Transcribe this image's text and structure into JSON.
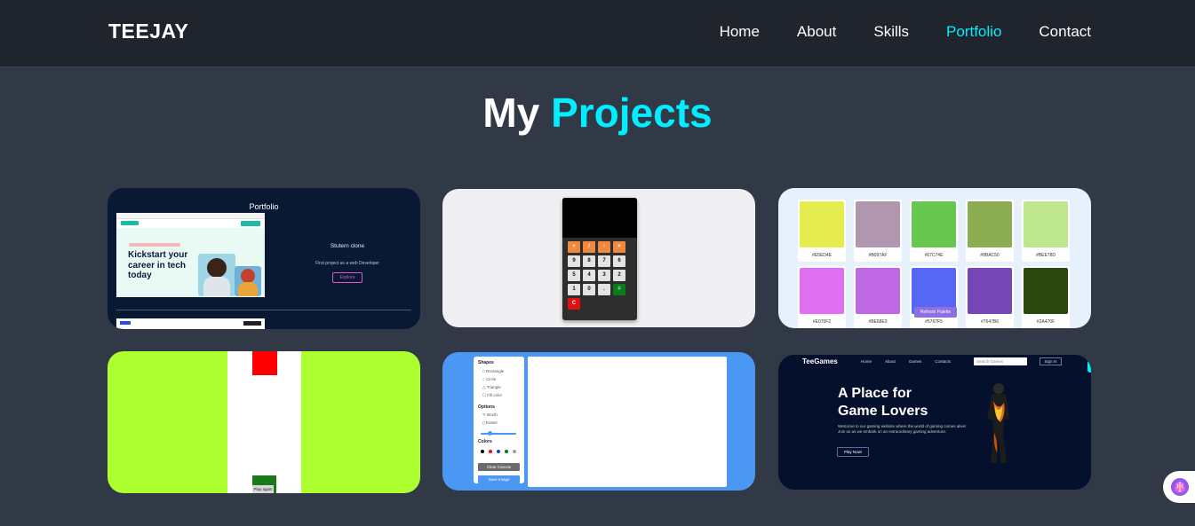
{
  "brand": "TEEJAY",
  "nav": {
    "items": [
      {
        "label": "Home",
        "active": false
      },
      {
        "label": "About",
        "active": false
      },
      {
        "label": "Skills",
        "active": false
      },
      {
        "label": "Portfolio",
        "active": true
      },
      {
        "label": "Contact",
        "active": false
      }
    ]
  },
  "heading": {
    "prefix": "My",
    "accent": "Projects"
  },
  "projects": {
    "portfolio": {
      "title": "Portfolio",
      "hero_text": "Kickstart your career in tech today",
      "item_title": "Stutern clone",
      "item_desc": "First project as a web Developer",
      "item_button": "Explore"
    },
    "calculator": {
      "keys": [
        "+",
        "/",
        "-",
        "×",
        "9",
        "8",
        "7",
        "6",
        "5",
        "4",
        "3",
        "2",
        "1",
        "0",
        ".",
        "=",
        "C"
      ]
    },
    "palette": {
      "swatches": [
        {
          "hex": "#E5ED4E",
          "color": "#e5ed4e"
        },
        {
          "hex": "#B097AF",
          "color": "#b097af"
        },
        {
          "hex": "#67C74E",
          "color": "#67c74e"
        },
        {
          "hex": "#8BAC50",
          "color": "#8bac50"
        },
        {
          "hex": "#BEE78D",
          "color": "#bee78d"
        },
        {
          "hex": "#E070F2",
          "color": "#e070f2"
        },
        {
          "hex": "#BE68E3",
          "color": "#be68e3"
        },
        {
          "hex": "#5767F5",
          "color": "#5767f5"
        },
        {
          "hex": "#7647B6",
          "color": "#7647b6"
        },
        {
          "hex": "#2A470F",
          "color": "#2a470f"
        }
      ],
      "button": "Refresh Palette"
    },
    "game": {
      "button": "Play again"
    },
    "paint": {
      "shapes_heading": "Shapes",
      "shapes": [
        "Rectangle",
        "Circle",
        "Triangle",
        "Fill color"
      ],
      "options_heading": "Options",
      "options": [
        "Brush",
        "Eraser"
      ],
      "colors_heading": "Colors",
      "colors": [
        "#000000",
        "#e31010",
        "#1b3fd6",
        "#0a7a1a",
        "#9aa0a6"
      ],
      "clear_button": "Clear Canvas",
      "save_button": "Save Image"
    },
    "teegames": {
      "brand": "TeeGames",
      "links": [
        "Home",
        "About",
        "Games",
        "Contacts"
      ],
      "search_placeholder": "Search Games",
      "signin": "Sign In",
      "headline": "A Place for Game Lovers",
      "paragraph": "Welcome to our gaming website where the world of gaming comes alive! Join us as we embark on an extraordinary gaming adventure.",
      "play_button": "Play Now!"
    }
  },
  "colors": {
    "accent": "#00eeff",
    "background": "#323946",
    "header": "#1f242d"
  }
}
